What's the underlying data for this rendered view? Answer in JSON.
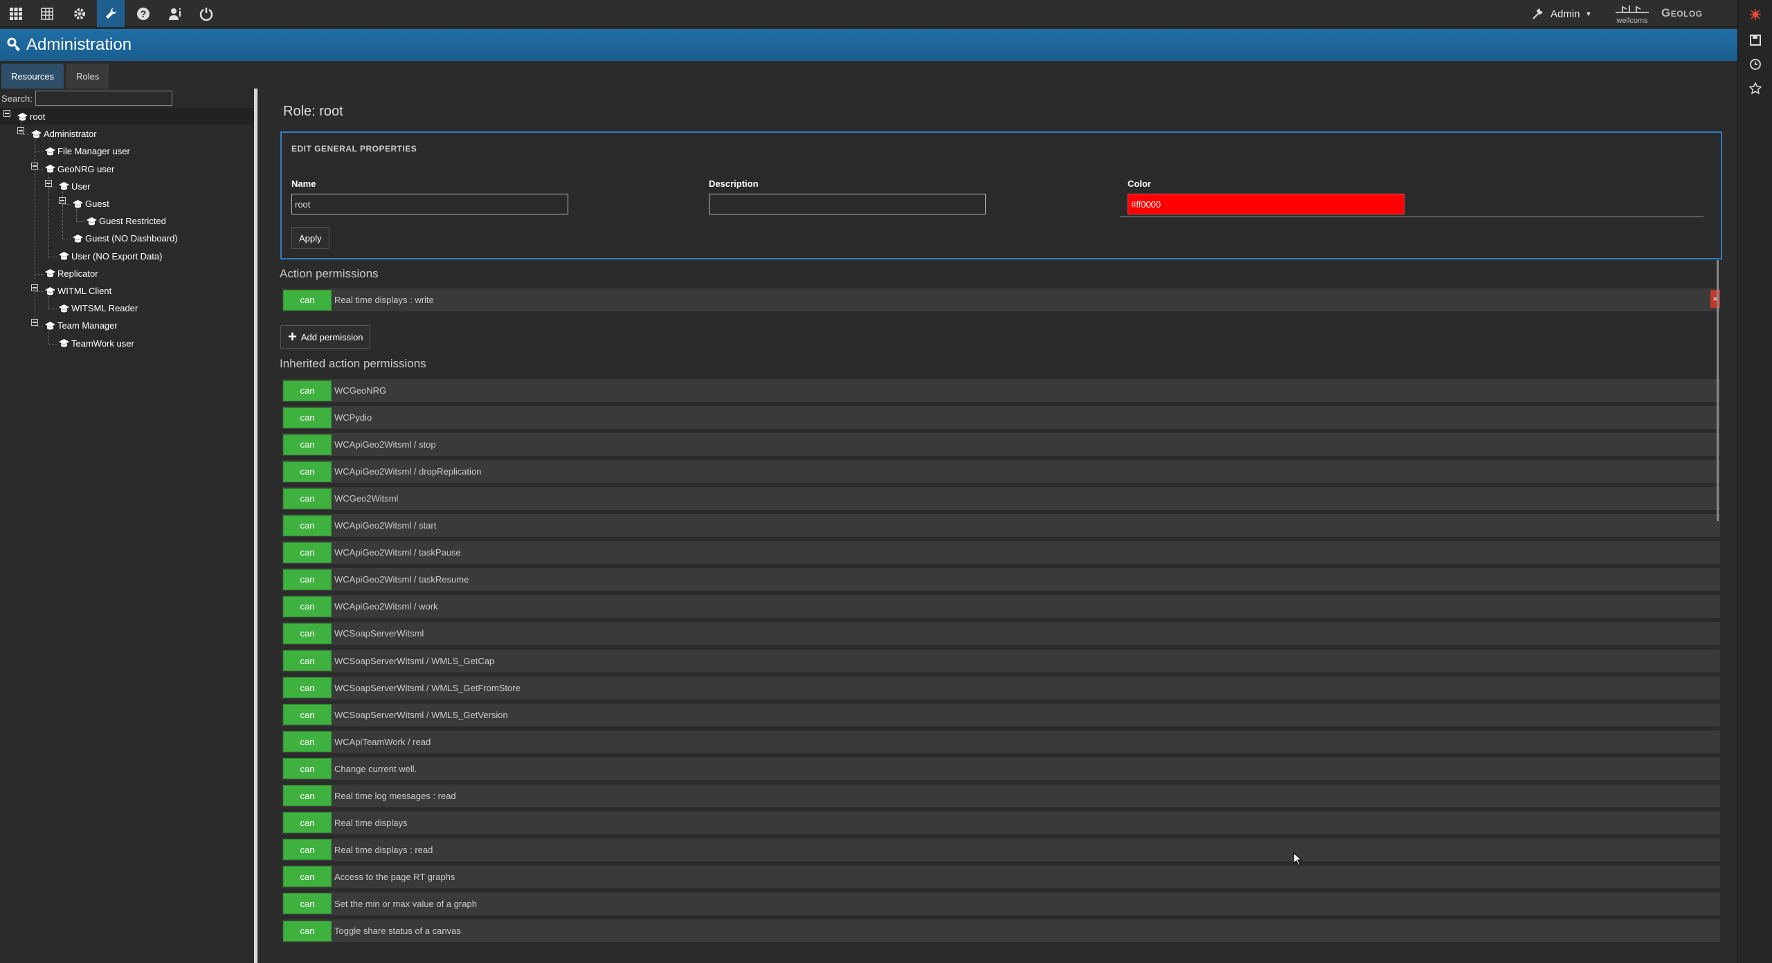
{
  "admin_menu": {
    "label": "Admin"
  },
  "logos": {
    "geolog": "Geolog",
    "wellcoms": "wellcoms"
  },
  "header": {
    "title": "Administration"
  },
  "tabs": [
    {
      "label": "Resources",
      "active": true
    },
    {
      "label": "Roles",
      "active": false
    }
  ],
  "sidebar": {
    "search_label": "Search:",
    "search_value": "",
    "tree": [
      {
        "label": "root",
        "depth": 0,
        "expandable": true
      },
      {
        "label": "Administrator",
        "depth": 1,
        "expandable": true
      },
      {
        "label": "File Manager user",
        "depth": 2,
        "expandable": false
      },
      {
        "label": "GeoNRG user",
        "depth": 2,
        "expandable": true
      },
      {
        "label": "User",
        "depth": 3,
        "expandable": true
      },
      {
        "label": "Guest",
        "depth": 4,
        "expandable": true
      },
      {
        "label": "Guest Restricted",
        "depth": 5,
        "expandable": false
      },
      {
        "label": "Guest (NO Dashboard)",
        "depth": 4,
        "expandable": false
      },
      {
        "label": "User (NO Export Data)",
        "depth": 3,
        "expandable": false
      },
      {
        "label": "Replicator",
        "depth": 2,
        "expandable": false
      },
      {
        "label": "WITML Client",
        "depth": 2,
        "expandable": true
      },
      {
        "label": "WITSML Reader",
        "depth": 3,
        "expandable": false
      },
      {
        "label": "Team Manager",
        "depth": 2,
        "expandable": true
      },
      {
        "label": "TeamWork user",
        "depth": 3,
        "expandable": false
      }
    ]
  },
  "main": {
    "role_title": "Role: root",
    "props": {
      "legend": "EDIT GENERAL PROPERTIES",
      "name_label": "Name",
      "name_value": "root",
      "description_label": "Description",
      "description_value": "",
      "color_label": "Color",
      "color_value": "#ff0000",
      "apply_label": "Apply"
    },
    "action_permissions_title": "Action permissions",
    "action_permissions": [
      {
        "badge": "can",
        "text": "Real time displays : write"
      }
    ],
    "delete_glyph": "×",
    "add_permission_label": "Add permission",
    "inherited_title": "Inherited action permissions",
    "inherited": [
      {
        "badge": "can",
        "text": "WCGeoNRG"
      },
      {
        "badge": "can",
        "text": "WCPydio"
      },
      {
        "badge": "can",
        "text": "WCApiGeo2Witsml / stop"
      },
      {
        "badge": "can",
        "text": "WCApiGeo2Witsml / dropReplication"
      },
      {
        "badge": "can",
        "text": "WCGeo2Witsml"
      },
      {
        "badge": "can",
        "text": "WCApiGeo2Witsml / start"
      },
      {
        "badge": "can",
        "text": "WCApiGeo2Witsml / taskPause"
      },
      {
        "badge": "can",
        "text": "WCApiGeo2Witsml / taskResume"
      },
      {
        "badge": "can",
        "text": "WCApiGeo2Witsml / work"
      },
      {
        "badge": "can",
        "text": "WCSoapServerWitsml"
      },
      {
        "badge": "can",
        "text": "WCSoapServerWitsml / WMLS_GetCap"
      },
      {
        "badge": "can",
        "text": "WCSoapServerWitsml / WMLS_GetFromStore"
      },
      {
        "badge": "can",
        "text": "WCSoapServerWitsml / WMLS_GetVersion"
      },
      {
        "badge": "can",
        "text": "WCApiTeamWork / read"
      },
      {
        "badge": "can",
        "text": "Change current well."
      },
      {
        "badge": "can",
        "text": "Real time log messages : read"
      },
      {
        "badge": "can",
        "text": "Real time displays"
      },
      {
        "badge": "can",
        "text": "Real time displays : read"
      },
      {
        "badge": "can",
        "text": "Access to the page RT graphs"
      },
      {
        "badge": "can",
        "text": "Set the min or max value of a graph"
      },
      {
        "badge": "can",
        "text": "Toggle share status of a canvas"
      }
    ]
  },
  "colors": {
    "accent": "#1f6ea6",
    "can_green": "#3fb13f",
    "border_blue": "#2d7fc5",
    "delete_red": "#c0392b"
  }
}
